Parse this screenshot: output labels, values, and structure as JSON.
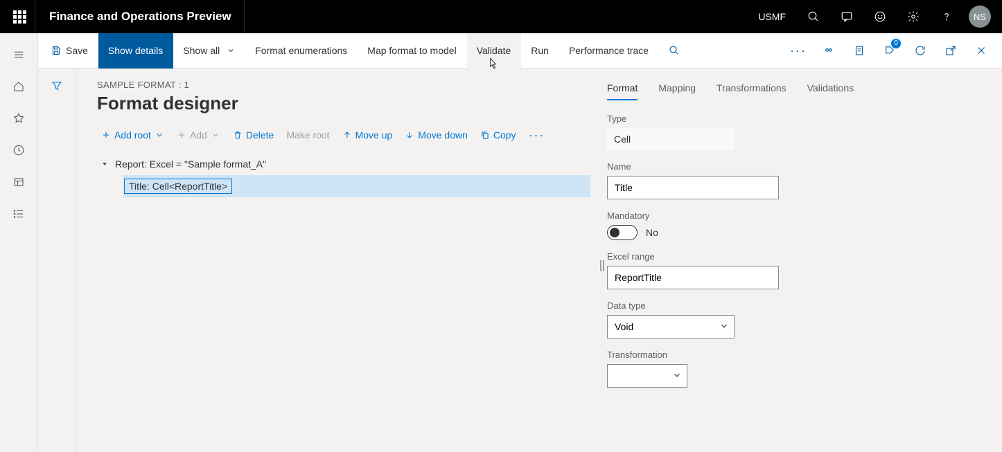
{
  "header": {
    "brand": "Finance and Operations Preview",
    "entity": "USMF",
    "avatar_initials": "NS"
  },
  "actionbar": {
    "save": "Save",
    "show_details": "Show details",
    "show_all": "Show all",
    "format_enumerations": "Format enumerations",
    "map_format_to_model": "Map format to model",
    "validate": "Validate",
    "run": "Run",
    "performance_trace": "Performance trace",
    "attach_badge": "0"
  },
  "page": {
    "breadcrumb": "SAMPLE FORMAT : 1",
    "title": "Format designer"
  },
  "tree_toolbar": {
    "add_root": "Add root",
    "add": "Add",
    "delete": "Delete",
    "make_root": "Make root",
    "move_up": "Move up",
    "move_down": "Move down",
    "copy": "Copy"
  },
  "tree": {
    "root_label": "Report: Excel = \"Sample format_A\"",
    "child_label": "Title: Cell<ReportTitle>"
  },
  "tabs": {
    "format": "Format",
    "mapping": "Mapping",
    "transformations": "Transformations",
    "validations": "Validations"
  },
  "props": {
    "type_label": "Type",
    "type_value": "Cell",
    "name_label": "Name",
    "name_value": "Title",
    "mandatory_label": "Mandatory",
    "mandatory_value": "No",
    "excel_range_label": "Excel range",
    "excel_range_value": "ReportTitle",
    "data_type_label": "Data type",
    "data_type_value": "Void",
    "transformation_label": "Transformation",
    "transformation_value": ""
  }
}
